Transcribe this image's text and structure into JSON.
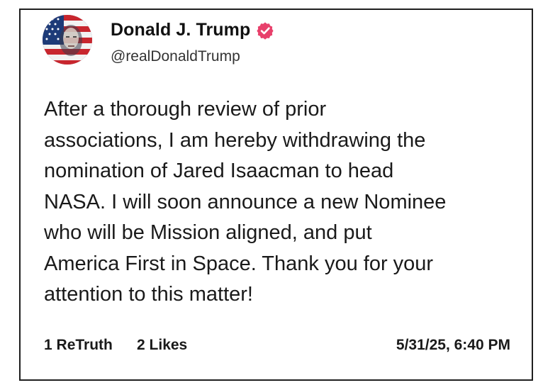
{
  "post": {
    "author": {
      "display_name": "Donald J. Trump",
      "handle": "@realDonaldTrump",
      "verified": true,
      "avatar_icon": "flag-portrait-avatar",
      "verified_icon": "verified-badge-icon",
      "verified_color": "#e8406b"
    },
    "text_lines": [
      "After a thorough review of prior",
      "associations, I am hereby withdrawing the",
      "nomination of Jared Isaacman to head",
      "NASA. I will soon announce a new Nominee",
      "who will be Mission aligned, and put",
      "America First in Space. Thank you for your",
      "attention to this matter!"
    ],
    "stats": {
      "retruths_count": "1",
      "retruths_label": "ReTruth",
      "likes_count": "2",
      "likes_label": "Likes"
    },
    "timestamp": "5/31/25, 6:40 PM"
  }
}
